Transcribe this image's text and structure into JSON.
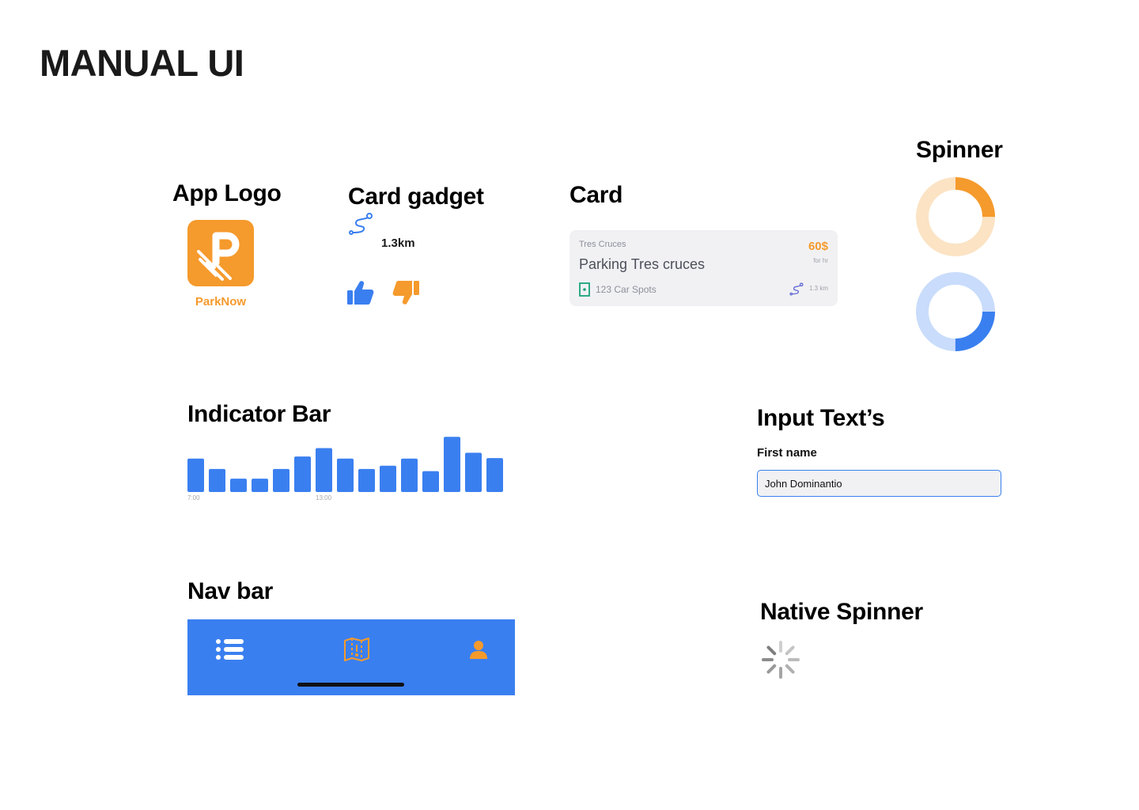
{
  "page": {
    "title": "MANUAL UI"
  },
  "sections": {
    "app_logo": "App Logo",
    "card_gadget": "Card gadget",
    "card": "Card",
    "spinner": "Spinner",
    "indicator_bar": "Indicator Bar",
    "input_texts": "Input Text’s",
    "nav_bar": "Nav bar",
    "native_spinner": "Native Spinner"
  },
  "logo": {
    "name": "ParkNow",
    "color": "#f59a2c"
  },
  "gadget": {
    "distance": "1.3km",
    "route_icon": "route-icon",
    "like_icon": "thumbs-up-icon",
    "dislike_icon": "thumbs-down-icon"
  },
  "card": {
    "subtitle": "Tres Cruces",
    "title": "Parking Tres cruces",
    "price": "60$",
    "price_unit": "for hr",
    "spots": "123 Car Spots",
    "distance": "1.3 km"
  },
  "spinners": [
    {
      "name": "orange",
      "track": "#fbe3c4",
      "arc": "#f59a2c",
      "progress": 0.25
    },
    {
      "name": "blue",
      "track": "#c9dcfb",
      "arc": "#3a7ff0",
      "progress": 0.25
    }
  ],
  "chart_data": {
    "type": "bar",
    "values": [
      8,
      5.5,
      3.2,
      3.2,
      5.5,
      8.5,
      10.5,
      8,
      5.5,
      6.3,
      8,
      5,
      13.2,
      9.4,
      8.1
    ],
    "tick_labels": [
      {
        "index": 0,
        "label": "7:00"
      },
      {
        "index": 6,
        "label": "13:00"
      }
    ],
    "ylim": [
      0,
      14
    ],
    "color": "#3a7ff0"
  },
  "input": {
    "label": "First name",
    "value": "John Dominantio",
    "border_color": "#3a7ff0"
  },
  "navbar": {
    "background": "#3a7ff0",
    "items": [
      {
        "icon": "list-icon",
        "color": "#ffffff"
      },
      {
        "icon": "map-icon",
        "color": "#f59a2c"
      },
      {
        "icon": "user-icon",
        "color": "#f59a2c"
      }
    ]
  },
  "colors": {
    "accent": "#f59a2c",
    "primary": "#3a7ff0"
  }
}
